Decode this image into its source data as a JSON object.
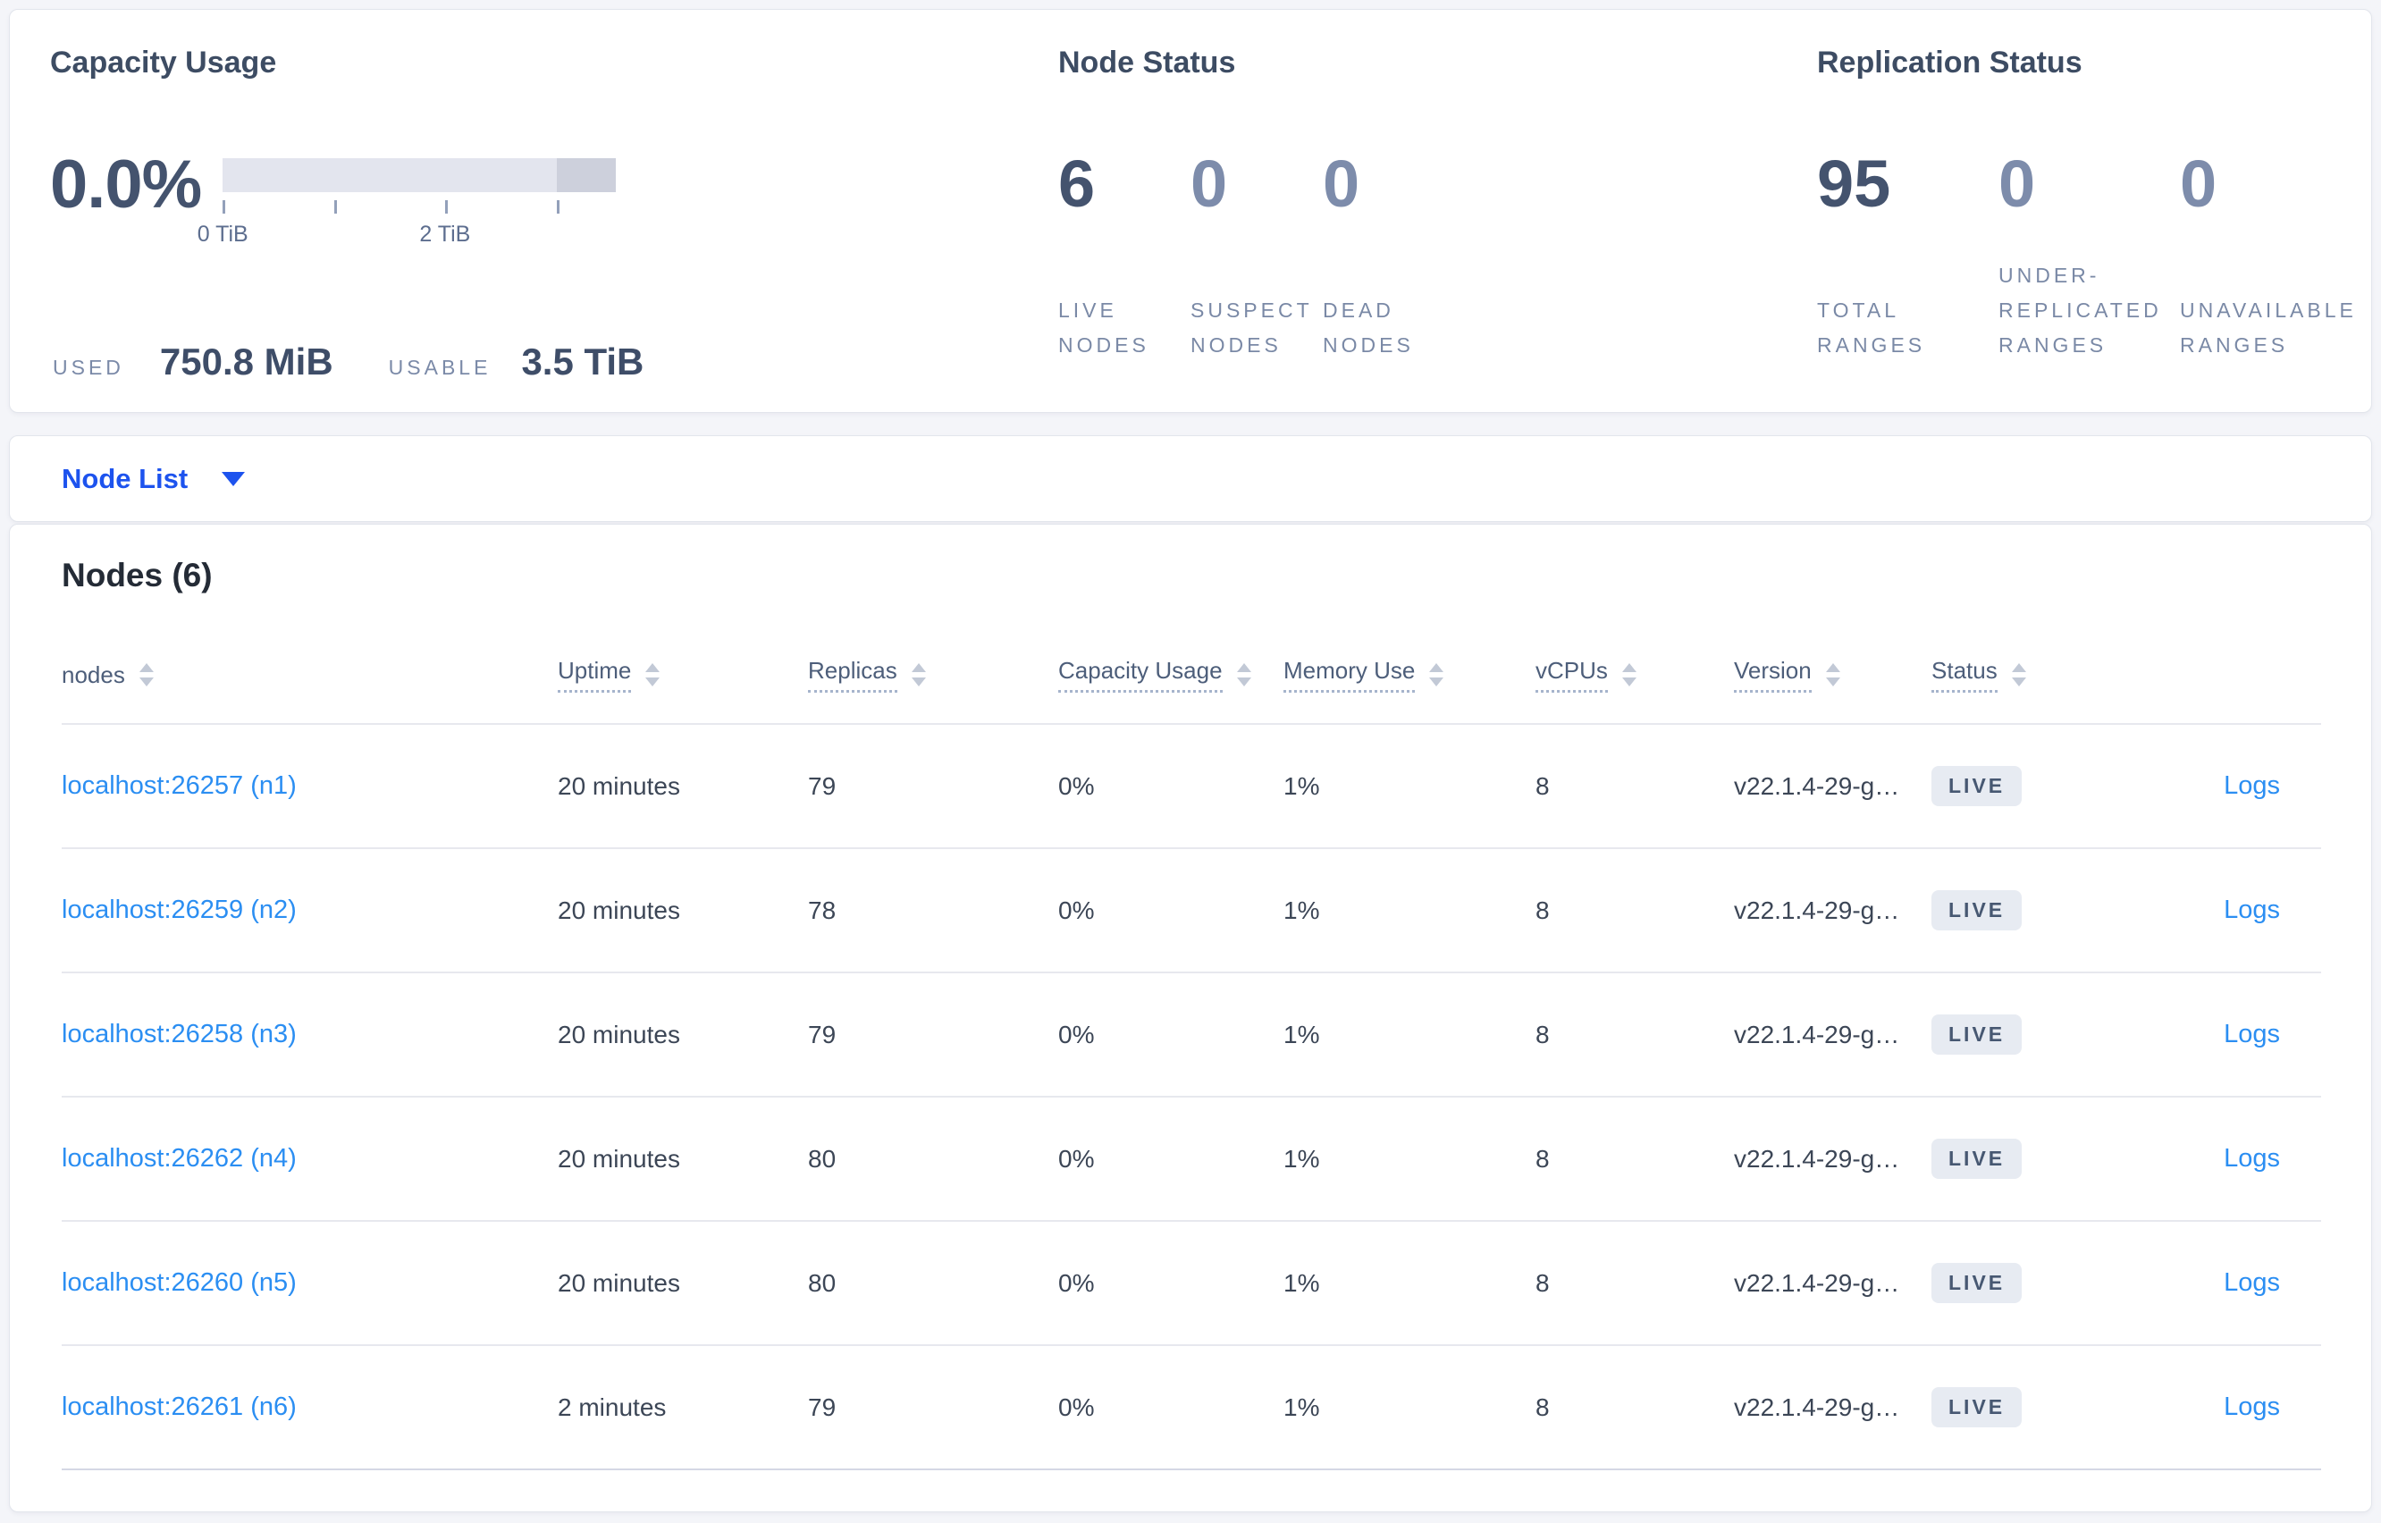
{
  "colors": {
    "primary_blue": "#1d53ee",
    "link_azure": "#2b8ef2",
    "dark_slate": "#44536e",
    "muted_number": "#7d8cab",
    "label_gray": "#7a89a6",
    "badge_bg": "#e7ebf2",
    "bar_light": "#e3e5ee",
    "bar_dark": "#cdd0dc"
  },
  "capacity_panel": {
    "title": "Capacity Usage",
    "percent": "0.0%",
    "tick_label_0": "0 TiB",
    "tick_label_2": "2 TiB",
    "used_label": "USED",
    "used_value": "750.8 MiB",
    "usable_label": "USABLE",
    "usable_value": "3.5 TiB"
  },
  "node_status_panel": {
    "title": "Node Status",
    "live": {
      "value": "6",
      "label": "LIVE NODES"
    },
    "suspect": {
      "value": "0",
      "label": "SUSPECT NODES"
    },
    "dead": {
      "value": "0",
      "label": "DEAD NODES"
    }
  },
  "replication_panel": {
    "title": "Replication Status",
    "total": {
      "value": "95",
      "label": "TOTAL RANGES"
    },
    "under_replicated": {
      "value": "0",
      "label": "UNDER-REPLICATED RANGES"
    },
    "unavailable": {
      "value": "0",
      "label": "UNAVAILABLE RANGES"
    }
  },
  "node_list_bar": {
    "label": "Node List"
  },
  "nodes_section": {
    "title": "Nodes (6)",
    "headers": {
      "nodes": "nodes",
      "uptime": "Uptime",
      "replicas": "Replicas",
      "capacity": "Capacity Usage",
      "memory": "Memory Use",
      "vcpus": "vCPUs",
      "version": "Version",
      "status": "Status"
    },
    "logs_label": "Logs",
    "rows": [
      {
        "node": "localhost:26257 (n1)",
        "uptime": "20 minutes",
        "replicas": "79",
        "capacity": "0%",
        "memory": "1%",
        "vcpus": "8",
        "version": "v22.1.4-29-g…",
        "status": "LIVE"
      },
      {
        "node": "localhost:26259 (n2)",
        "uptime": "20 minutes",
        "replicas": "78",
        "capacity": "0%",
        "memory": "1%",
        "vcpus": "8",
        "version": "v22.1.4-29-g…",
        "status": "LIVE"
      },
      {
        "node": "localhost:26258 (n3)",
        "uptime": "20 minutes",
        "replicas": "79",
        "capacity": "0%",
        "memory": "1%",
        "vcpus": "8",
        "version": "v22.1.4-29-g…",
        "status": "LIVE"
      },
      {
        "node": "localhost:26262 (n4)",
        "uptime": "20 minutes",
        "replicas": "80",
        "capacity": "0%",
        "memory": "1%",
        "vcpus": "8",
        "version": "v22.1.4-29-g…",
        "status": "LIVE"
      },
      {
        "node": "localhost:26260 (n5)",
        "uptime": "20 minutes",
        "replicas": "80",
        "capacity": "0%",
        "memory": "1%",
        "vcpus": "8",
        "version": "v22.1.4-29-g…",
        "status": "LIVE"
      },
      {
        "node": "localhost:26261 (n6)",
        "uptime": "2 minutes",
        "replicas": "79",
        "capacity": "0%",
        "memory": "1%",
        "vcpus": "8",
        "version": "v22.1.4-29-g…",
        "status": "LIVE"
      }
    ]
  }
}
